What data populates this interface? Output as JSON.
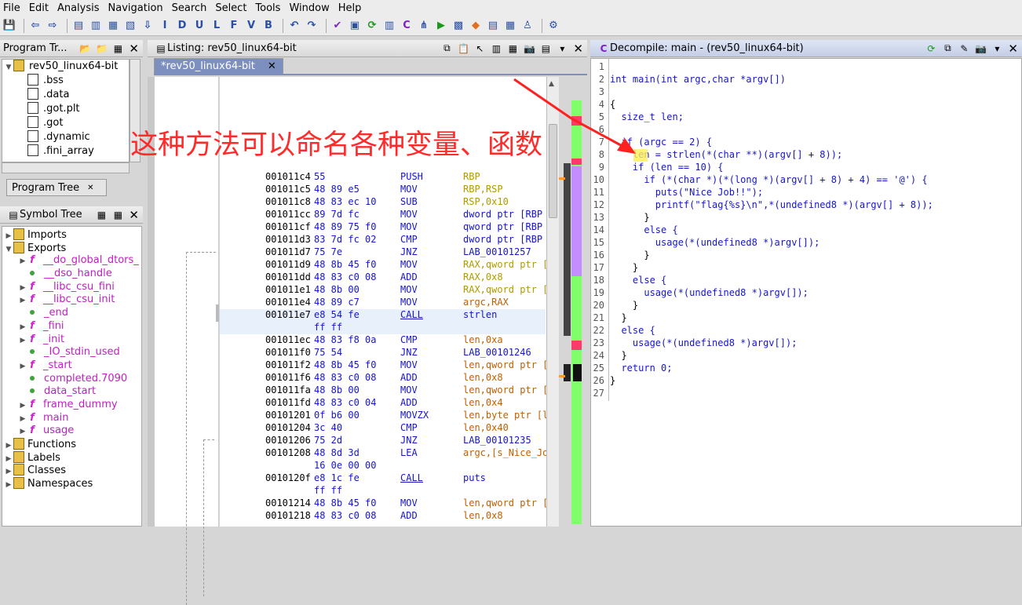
{
  "menu": [
    "File",
    "Edit",
    "Analysis",
    "Navigation",
    "Search",
    "Select",
    "Tools",
    "Window",
    "Help"
  ],
  "toolbar_letters": [
    "I",
    "D",
    "U",
    "L",
    "F",
    "V",
    "B"
  ],
  "program_trees": {
    "title": "Program Tr...",
    "root": "rev50_linux64-bit",
    "items": [
      ".bss",
      ".data",
      ".got.plt",
      ".got",
      ".dynamic",
      ".fini_array"
    ],
    "tab_label": "Program Tree"
  },
  "symbol_tree": {
    "title": "Symbol Tree",
    "items": [
      {
        "label": "Imports",
        "kind": "folder",
        "indent": 0,
        "tw": "▶"
      },
      {
        "label": "Exports",
        "kind": "folder",
        "indent": 0,
        "tw": "▼"
      },
      {
        "label": "__do_global_dtors_",
        "kind": "func",
        "indent": 1,
        "tw": "▶"
      },
      {
        "label": "__dso_handle",
        "kind": "data",
        "indent": 1,
        "tw": ""
      },
      {
        "label": "__libc_csu_fini",
        "kind": "func",
        "indent": 1,
        "tw": "▶"
      },
      {
        "label": "__libc_csu_init",
        "kind": "func",
        "indent": 1,
        "tw": "▶"
      },
      {
        "label": "_end",
        "kind": "data",
        "indent": 1,
        "tw": ""
      },
      {
        "label": "_fini",
        "kind": "func",
        "indent": 1,
        "tw": "▶"
      },
      {
        "label": "_init",
        "kind": "func",
        "indent": 1,
        "tw": "▶"
      },
      {
        "label": "_IO_stdin_used",
        "kind": "data",
        "indent": 1,
        "tw": ""
      },
      {
        "label": "_start",
        "kind": "func",
        "indent": 1,
        "tw": "▶"
      },
      {
        "label": "completed.7090",
        "kind": "data",
        "indent": 1,
        "tw": ""
      },
      {
        "label": "data_start",
        "kind": "data",
        "indent": 1,
        "tw": ""
      },
      {
        "label": "frame_dummy",
        "kind": "func",
        "indent": 1,
        "tw": "▶"
      },
      {
        "label": "main",
        "kind": "func",
        "indent": 1,
        "tw": "▶"
      },
      {
        "label": "usage",
        "kind": "func",
        "indent": 1,
        "tw": "▶"
      },
      {
        "label": "Functions",
        "kind": "ffolder",
        "indent": 0,
        "tw": "▶"
      },
      {
        "label": "Labels",
        "kind": "folder",
        "indent": 0,
        "tw": "▶"
      },
      {
        "label": "Classes",
        "kind": "cfolder",
        "indent": 0,
        "tw": "▶"
      },
      {
        "label": "Namespaces",
        "kind": "nfolder",
        "indent": 0,
        "tw": "▶"
      }
    ]
  },
  "listing": {
    "title": "Listing: rev50_linux64-bit",
    "tab": "*rev50_linux64-bit",
    "rows": [
      {
        "a": "001011c4",
        "b": "55",
        "m": "PUSH",
        "o": "RBP"
      },
      {
        "a": "001011c5",
        "b": "48 89 e5",
        "m": "MOV",
        "o": "RBP,RSP"
      },
      {
        "a": "001011c8",
        "b": "48 83 ec 10",
        "m": "SUB",
        "o": "RSP,0x10"
      },
      {
        "a": "001011cc",
        "b": "89 7d fc",
        "m": "MOV",
        "o": "dword ptr [RBP"
      },
      {
        "a": "001011cf",
        "b": "48 89 75 f0",
        "m": "MOV",
        "o": "qword ptr [RBP"
      },
      {
        "a": "001011d3",
        "b": "83 7d fc 02",
        "m": "CMP",
        "o": "dword ptr [RBP"
      },
      {
        "a": "001011d7",
        "b": "75 7e",
        "m": "JNZ",
        "o": "LAB_00101257"
      },
      {
        "a": "001011d9",
        "b": "48 8b 45 f0",
        "m": "MOV",
        "o": "RAX,qword ptr ["
      },
      {
        "a": "001011dd",
        "b": "48 83 c0 08",
        "m": "ADD",
        "o": "RAX,0x8"
      },
      {
        "a": "001011e1",
        "b": "48 8b 00",
        "m": "MOV",
        "o": "RAX,qword ptr ["
      },
      {
        "a": "001011e4",
        "b": "48 89 c7",
        "m": "MOV",
        "o": "argc,RAX"
      },
      {
        "a": "001011e7",
        "b": "e8 54 fe",
        "m": "CALL",
        "o": "strlen"
      },
      {
        "a": "",
        "b": "ff ff",
        "m": "",
        "o": ""
      },
      {
        "a": "001011ec",
        "b": "48 83 f8 0a",
        "m": "CMP",
        "o": "len,0xa"
      },
      {
        "a": "001011f0",
        "b": "75 54",
        "m": "JNZ",
        "o": "LAB_00101246"
      },
      {
        "a": "001011f2",
        "b": "48 8b 45 f0",
        "m": "MOV",
        "o": "len,qword ptr ["
      },
      {
        "a": "001011f6",
        "b": "48 83 c0 08",
        "m": "ADD",
        "o": "len,0x8"
      },
      {
        "a": "001011fa",
        "b": "48 8b 00",
        "m": "MOV",
        "o": "len,qword ptr ["
      },
      {
        "a": "001011fd",
        "b": "48 83 c0 04",
        "m": "ADD",
        "o": "len,0x4"
      },
      {
        "a": "00101201",
        "b": "0f b6 00",
        "m": "MOVZX",
        "o": "len,byte ptr [l"
      },
      {
        "a": "00101204",
        "b": "3c 40",
        "m": "CMP",
        "o": "len,0x40"
      },
      {
        "a": "00101206",
        "b": "75 2d",
        "m": "JNZ",
        "o": "LAB_00101235"
      },
      {
        "a": "00101208",
        "b": "48 8d 3d",
        "m": "LEA",
        "o": "argc,[s_Nice_Jo"
      },
      {
        "a": "",
        "b": "16 0e 00 00",
        "m": "",
        "o": ""
      },
      {
        "a": "0010120f",
        "b": "e8 1c fe",
        "m": "CALL",
        "o": "puts"
      },
      {
        "a": "",
        "b": "ff ff",
        "m": "",
        "o": ""
      },
      {
        "a": "00101214",
        "b": "48 8b 45 f0",
        "m": "MOV",
        "o": "len,qword ptr ["
      },
      {
        "a": "00101218",
        "b": "48 83 c0 08",
        "m": "ADD",
        "o": "len,0x8"
      }
    ]
  },
  "annotation": {
    "text": "这种方法可以命名各种变量、函数",
    "color": "#ff2a2a"
  },
  "decompile": {
    "title": "Decompile: main -  (rev50_linux64-bit)",
    "lines": [
      "",
      "int main(int argc,char *argv[])",
      "",
      "{",
      "  size_t len;",
      "  ",
      "  if (argc == 2) {",
      "    len = strlen(*(char **)(argv[] + 8));",
      "    if (len == 10) {",
      "      if (*(char *)(*(long *)(argv[] + 8) + 4) == '@') {",
      "        puts(\"Nice Job!!\");",
      "        printf(\"flag{%s}\\n\",*(undefined8 *)(argv[] + 8));",
      "      }",
      "      else {",
      "        usage(*(undefined8 *)argv[]);",
      "      }",
      "    }",
      "    else {",
      "      usage(*(undefined8 *)argv[]);",
      "    }",
      "  }",
      "  else {",
      "    usage(*(undefined8 *)argv[]);",
      "  }",
      "  return 0;",
      "}",
      ""
    ]
  }
}
